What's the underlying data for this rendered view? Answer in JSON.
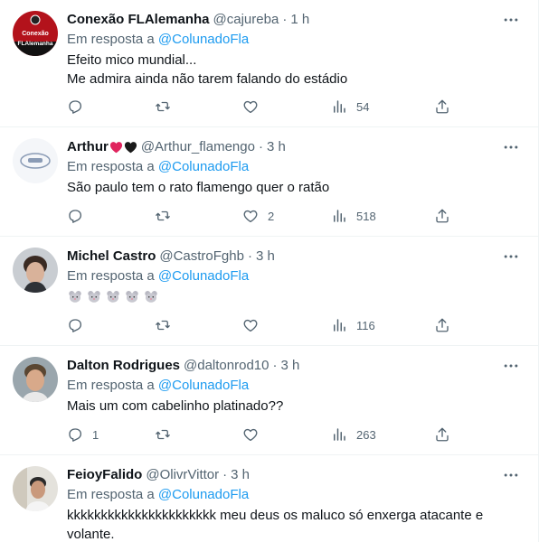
{
  "tweets": [
    {
      "name": "Conexão FLAlemanha",
      "handle": "@cajureba",
      "sep": "·",
      "time": "1 h",
      "reply_prefix": "Em resposta a",
      "reply_to": "@ColunadoFla",
      "lines": [
        "Efeito mico mundial...",
        "Me admira ainda não tarem falando do estádio"
      ],
      "replies": "",
      "retweets": "",
      "likes": "",
      "views": "54",
      "avatar_lines": [
        "Conexão",
        "FLAlemanha"
      ]
    },
    {
      "name": "Arthur",
      "handle": "@Arthur_flamengo",
      "sep": "·",
      "time": "3 h",
      "reply_prefix": "Em resposta a",
      "reply_to": "@ColunadoFla",
      "lines": [
        "São paulo tem o rato flamengo quer o ratão"
      ],
      "replies": "",
      "retweets": "",
      "likes": "2",
      "views": "518"
    },
    {
      "name": "Michel Castro",
      "handle": "@CastroFghb",
      "sep": "·",
      "time": "3 h",
      "reply_prefix": "Em resposta a",
      "reply_to": "@ColunadoFla",
      "lines": [],
      "replies": "",
      "retweets": "",
      "likes": "",
      "views": "116"
    },
    {
      "name": "Dalton Rodrigues",
      "handle": "@daltonrod10",
      "sep": "·",
      "time": "3 h",
      "reply_prefix": "Em resposta a",
      "reply_to": "@ColunadoFla",
      "lines": [
        "Mais um com cabelinho platinado??"
      ],
      "replies": "1",
      "retweets": "",
      "likes": "",
      "views": "263"
    },
    {
      "name": "FeioyFalido",
      "handle": "@OlivrVittor",
      "sep": "·",
      "time": "3 h",
      "reply_prefix": "Em resposta a",
      "reply_to": "@ColunadoFla",
      "lines": [
        "kkkkkkkkkkkkkkkkkkkkkk meu deus os maluco só enxerga atacante e",
        "volante."
      ],
      "replies": "",
      "retweets": "",
      "likes": "",
      "views": ""
    }
  ],
  "colors": {
    "text": "#0f1419",
    "secondary": "#536471",
    "link": "#1d9bf0",
    "divider": "#eff3f4",
    "heart_red": "#e0245e",
    "heart_black": "#1a1a1a"
  },
  "icons": [
    "more-icon",
    "reply-icon",
    "retweet-icon",
    "like-icon",
    "views-icon",
    "share-icon",
    "mouse-emoji"
  ]
}
